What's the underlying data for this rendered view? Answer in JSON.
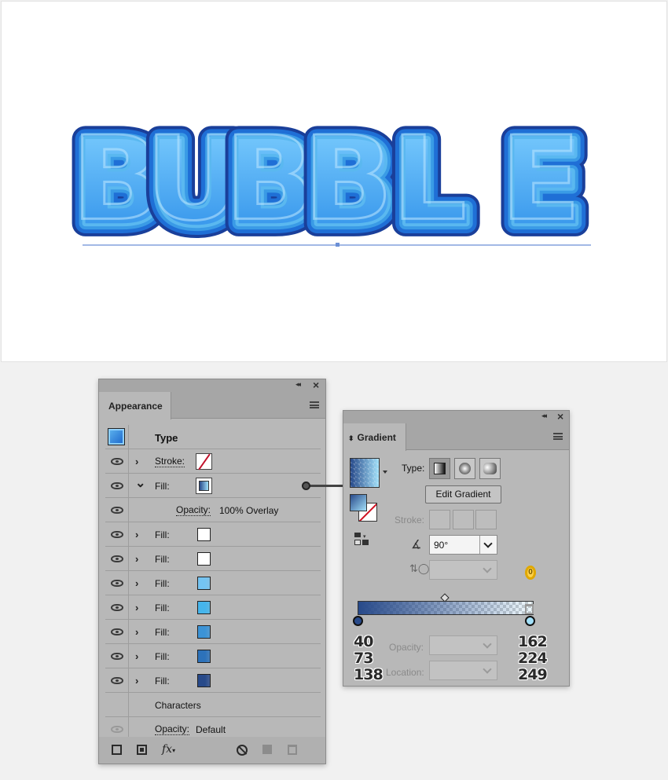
{
  "artwork": {
    "title_text": "BUBBLE",
    "colors": {
      "dark": "#1a3f9a",
      "mid": "#1f6fd6",
      "light": "#5ab8f0",
      "highlight": "#bfe8ff",
      "baseline": "#6b8fd6"
    }
  },
  "appearance": {
    "tab_label": "Appearance",
    "rows": [
      {
        "kind": "header",
        "label": "Type"
      },
      {
        "kind": "stroke",
        "label": "Stroke:",
        "swatch": "none"
      },
      {
        "kind": "fill",
        "label": "Fill:",
        "expanded": true,
        "swatch": "gradient"
      },
      {
        "kind": "opacity",
        "label": "Opacity:",
        "value": "100% Overlay"
      },
      {
        "kind": "fill",
        "label": "Fill:",
        "swatch": "#ffffff"
      },
      {
        "kind": "fill",
        "label": "Fill:",
        "swatch": "#ffffff"
      },
      {
        "kind": "fill",
        "label": "Fill:",
        "swatch": "#74c4f2"
      },
      {
        "kind": "fill",
        "label": "Fill:",
        "swatch": "#45b5ec"
      },
      {
        "kind": "fill",
        "label": "Fill:",
        "swatch": "#3c93d6"
      },
      {
        "kind": "fill",
        "label": "Fill:",
        "swatch": "#2d72ba"
      },
      {
        "kind": "fill",
        "label": "Fill:",
        "swatch": "#284a8a"
      },
      {
        "kind": "characters",
        "label": "Characters"
      },
      {
        "kind": "opacity-default",
        "label": "Opacity:",
        "value": "Default"
      }
    ],
    "footer_icons": [
      "add-stroke-icon",
      "add-fill-icon",
      "fx-icon",
      "clear-appearance-icon",
      "duplicate-icon",
      "delete-icon"
    ],
    "fx_label": "fx"
  },
  "gradient": {
    "tab_label": "Gradient",
    "type_label": "Type:",
    "edit_button": "Edit Gradient",
    "stroke_label": "Stroke:",
    "angle_value": "90°",
    "reverse_value": "0",
    "opacity_label": "Opacity:",
    "location_label": "Location:",
    "start_color": {
      "r": "40",
      "g": "73",
      "b": "138",
      "hex": "#284a8a"
    },
    "end_color": {
      "r": "162",
      "g": "224",
      "b": "249",
      "hex": "#a2e0f9"
    }
  }
}
